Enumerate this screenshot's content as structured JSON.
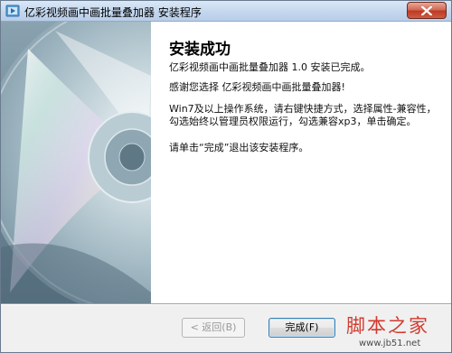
{
  "window": {
    "title": "亿彩视频画中画批量叠加器 安装程序"
  },
  "content": {
    "heading": "安装成功",
    "line_completed": "亿彩视频画中画批量叠加器 1.0 安装已完成。",
    "line_thanks": "感谢您选择 亿彩视频画中画批量叠加器!",
    "line_win7": "Win7及以上操作系统，请右键快捷方式，选择属性-兼容性，勾选始终以管理员权限运行，勾选兼容xp3，单击确定。",
    "line_exit": "请单击“完成”退出该安装程序。"
  },
  "buttons": {
    "back_label": "< 返回(B)",
    "finish_label": "完成(F)"
  },
  "watermark": {
    "chars": "脚本之家",
    "url": "www.jb51.net"
  },
  "colors": {
    "titlebar": "#c4d7ee",
    "close_button": "#c7432d",
    "watermark": "#d23a2e"
  }
}
